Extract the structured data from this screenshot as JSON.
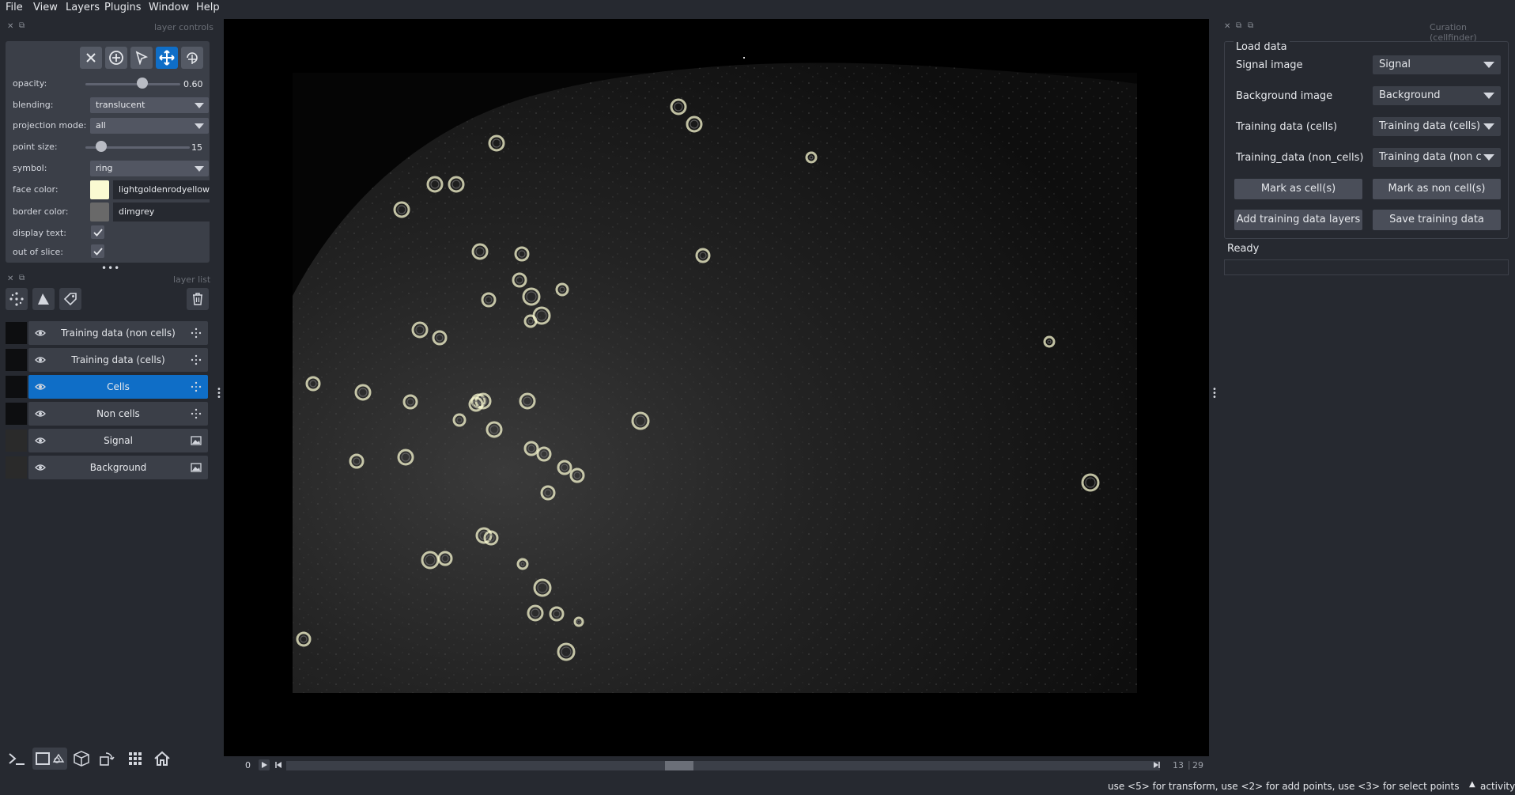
{
  "menu": [
    "File",
    "View",
    "Layers",
    "Plugins",
    "Window",
    "Help"
  ],
  "left_dock": {
    "controls_title": "layer controls",
    "list_title": "layer list",
    "controls": {
      "opacity_label": "opacity:",
      "opacity_value": "0.60",
      "opacity_fraction": 0.6,
      "blending_label": "blending:",
      "blending_value": "translucent",
      "projection_label": "projection mode:",
      "projection_value": "all",
      "point_size_label": "point size:",
      "point_size_value": "15",
      "point_size_fraction": 0.15,
      "symbol_label": "symbol:",
      "symbol_value": "ring",
      "face_color_label": "face color:",
      "face_color_value": "lightgoldenrodyellow",
      "face_color_hex": "#fafad2",
      "border_color_label": "border color:",
      "border_color_value": "dimgrey",
      "border_color_hex": "#696969",
      "display_text_label": "display text:",
      "display_text_checked": true,
      "out_of_slice_label": "out of slice:",
      "out_of_slice_checked": true
    },
    "tools": [
      "close-icon",
      "add-points-icon",
      "select-icon",
      "pan-zoom-icon",
      "transform-icon"
    ],
    "layers": [
      {
        "name": "Training data (non cells)",
        "type": "points",
        "selected": false
      },
      {
        "name": "Training data (cells)",
        "type": "points",
        "selected": false
      },
      {
        "name": "Cells",
        "type": "points",
        "selected": true
      },
      {
        "name": "Non cells",
        "type": "points",
        "selected": false
      },
      {
        "name": "Signal",
        "type": "image",
        "selected": false
      },
      {
        "name": "Background",
        "type": "image",
        "selected": false
      }
    ]
  },
  "dims": {
    "axis_index": "0",
    "current": "13",
    "total": "29"
  },
  "right_dock": {
    "title": "Curation (cellfinder)",
    "group_title": "Load data",
    "fields": [
      {
        "label": "Signal image",
        "value": "Signal"
      },
      {
        "label": "Background image",
        "value": "Background"
      },
      {
        "label": "Training data (cells)",
        "value": "Training data (cells)"
      },
      {
        "label": "Training_data (non_cells)",
        "value": "Training data (non c"
      }
    ],
    "buttons": [
      "Mark as cell(s)",
      "Mark as non cell(s)",
      "Add training data layers",
      "Save training data"
    ],
    "status": "Ready"
  },
  "status_bar": {
    "message": "use <5> for transform, use <2> for add points, use <3> for select points",
    "activity": "activity"
  },
  "colors": {
    "accent": "#0f6ec7",
    "background": "#262930",
    "panel": "#3b3f48"
  }
}
